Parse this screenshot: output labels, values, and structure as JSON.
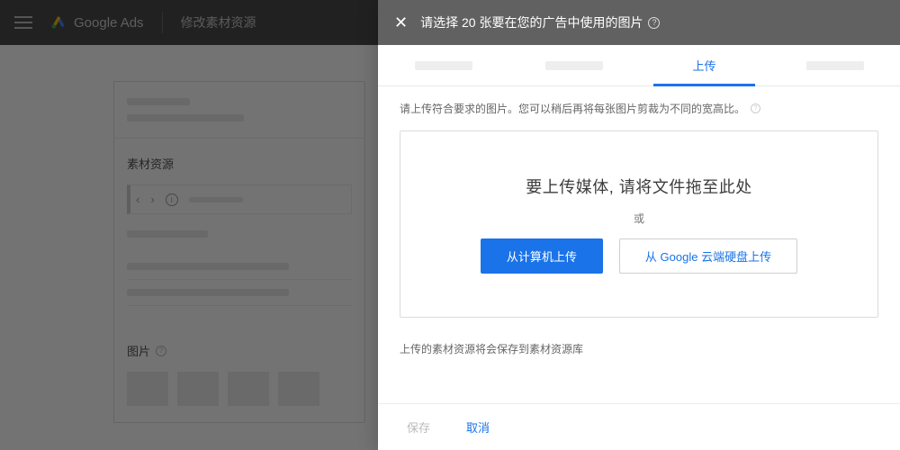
{
  "header": {
    "product": "Google Ads",
    "page_title": "修改素材资源"
  },
  "bg": {
    "section_assets": "素材资源",
    "section_images": "图片"
  },
  "modal": {
    "title": "请选择 20 张要在您的广告中使用的图片",
    "tabs": {
      "upload": "上传"
    },
    "hint": "请上传符合要求的图片。您可以稍后再将每张图片剪裁为不同的宽高比。",
    "dropzone": {
      "title": "要上传媒体, 请将文件拖至此处",
      "or": "或",
      "from_computer": "从计算机上传",
      "from_drive": "从 Google 云端硬盘上传"
    },
    "save_note": "上传的素材资源将会保存到素材资源库",
    "footer": {
      "save": "保存",
      "cancel": "取消"
    }
  }
}
